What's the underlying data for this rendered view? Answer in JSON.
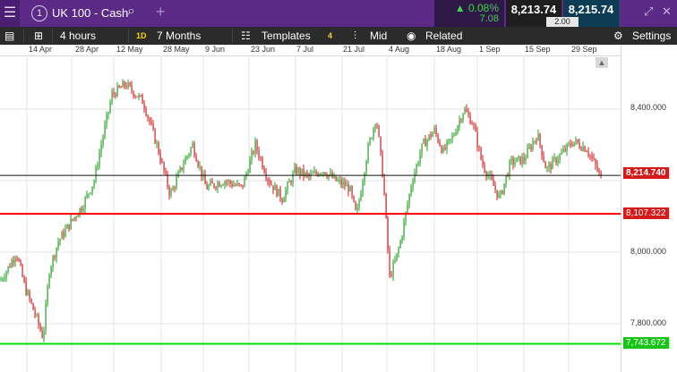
{
  "topbar": {
    "instrument_number": "1",
    "instrument_name": "UK 100 - Cash",
    "change_pct": "▲ 0.08%",
    "change_abs": "7.08",
    "sell_price": "8,213.74",
    "buy_price": "8,215.74",
    "spread": "2.00"
  },
  "toolbar": {
    "interval": "4 hours",
    "range_badge": "1D",
    "range": "7 Months",
    "templates": "Templates",
    "count_badge": "4",
    "price_type": "Mid",
    "related": "Related",
    "settings": "Settings"
  },
  "colors": {
    "up": "#1aa51a",
    "down": "#d41a1a",
    "support": "#ff0000",
    "support2": "#00e000",
    "brand": "#5a2a86"
  },
  "chart_data": {
    "type": "candlestick",
    "x_tick_labels": [
      "14 Apr",
      "28 Apr",
      "12 May",
      "28 May",
      "9 Jun",
      "23 Jun",
      "7 Jul",
      "21 Jul",
      "4 Aug",
      "18 Aug",
      "1 Sep",
      "15 Sep",
      "29 Sep"
    ],
    "y_tick_labels": [
      "8,400.000",
      "8,200.000",
      "8,000.000",
      "7,800.000"
    ],
    "y_ticks": [
      8400,
      8200,
      8000,
      7800
    ],
    "ylim": [
      7720,
      8500
    ],
    "current_price": 8214.74,
    "current_price_label": "8,214.740",
    "horizontal_lines": [
      {
        "value": 8107.322,
        "label": "8,107.322",
        "color": "#ff0000"
      },
      {
        "value": 7743.672,
        "label": "7,743.672",
        "color": "#00e000"
      }
    ],
    "price_path": [
      [
        0,
        7920
      ],
      [
        10,
        7960
      ],
      [
        18,
        8000
      ],
      [
        28,
        7900
      ],
      [
        40,
        7820
      ],
      [
        48,
        7760
      ],
      [
        55,
        7950
      ],
      [
        65,
        8030
      ],
      [
        78,
        8080
      ],
      [
        92,
        8130
      ],
      [
        105,
        8200
      ],
      [
        112,
        8290
      ],
      [
        125,
        8440
      ],
      [
        140,
        8470
      ],
      [
        160,
        8420
      ],
      [
        175,
        8300
      ],
      [
        190,
        8160
      ],
      [
        205,
        8250
      ],
      [
        215,
        8300
      ],
      [
        230,
        8180
      ],
      [
        250,
        8200
      ],
      [
        270,
        8180
      ],
      [
        285,
        8300
      ],
      [
        300,
        8200
      ],
      [
        315,
        8150
      ],
      [
        330,
        8230
      ],
      [
        345,
        8210
      ],
      [
        360,
        8230
      ],
      [
        375,
        8200
      ],
      [
        390,
        8180
      ],
      [
        398,
        8100
      ],
      [
        410,
        8280
      ],
      [
        420,
        8380
      ],
      [
        428,
        8200
      ],
      [
        435,
        7930
      ],
      [
        442,
        7980
      ],
      [
        448,
        8040
      ],
      [
        460,
        8200
      ],
      [
        472,
        8300
      ],
      [
        485,
        8340
      ],
      [
        495,
        8280
      ],
      [
        505,
        8320
      ],
      [
        518,
        8400
      ],
      [
        528,
        8360
      ],
      [
        538,
        8250
      ],
      [
        548,
        8200
      ],
      [
        558,
        8150
      ],
      [
        570,
        8250
      ],
      [
        585,
        8260
      ],
      [
        600,
        8330
      ],
      [
        610,
        8230
      ],
      [
        625,
        8270
      ],
      [
        640,
        8310
      ],
      [
        655,
        8290
      ],
      [
        665,
        8240
      ],
      [
        672,
        8200
      ]
    ]
  }
}
